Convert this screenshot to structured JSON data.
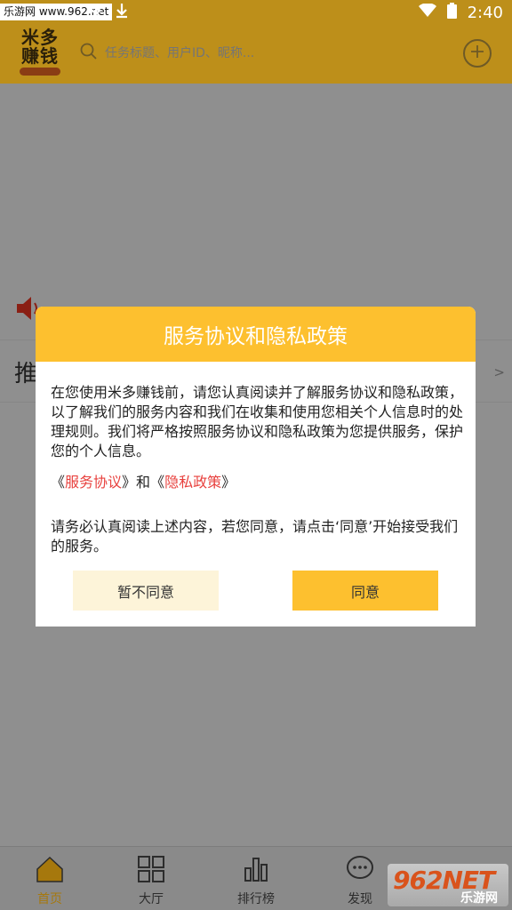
{
  "status_bar": {
    "watermark": "乐游网 www.962.net",
    "time": "2:40",
    "icons": [
      "notification-icon",
      "download-icon",
      "download-icon",
      "wifi-icon",
      "battery-icon"
    ]
  },
  "header": {
    "logo_line1": "米多",
    "logo_line2": "赚钱",
    "search_placeholder": "任务标题、用户ID、昵称..."
  },
  "page": {
    "section_title": "推",
    "more": ">"
  },
  "dialog": {
    "title": "服务协议和隐私政策",
    "body": "在您使用米多赚钱前，请您认真阅读并了解服务协议和隐私政策，以了解我们的服务内容和我们在收集和使用您相关个人信息时的处理规则。我们将严格按照服务协议和隐私政策为您提供服务，保护您的个人信息。",
    "link_open1": "《",
    "link_service": "服务协议",
    "link_close1": "》",
    "link_and": "和",
    "link_open2": "《",
    "link_privacy": "隐私政策",
    "link_close2": "》",
    "notice": "请务必认真阅读上述内容，若您同意，请点击‘同意’开始接受我们的服务。",
    "disagree": "暂不同意",
    "agree": "同意"
  },
  "bottom_nav": [
    {
      "label": "首页",
      "icon": "home-icon",
      "active": true
    },
    {
      "label": "大厅",
      "icon": "grid-icon",
      "active": false
    },
    {
      "label": "排行榜",
      "icon": "ranking-icon",
      "active": false
    },
    {
      "label": "发现",
      "icon": "chat-icon",
      "active": false
    }
  ],
  "watermark_bottom": {
    "big": "962NET",
    "small": "乐游网"
  },
  "colors": {
    "header_bg": "#bd8f1a",
    "dialog_accent": "#fdc02f",
    "link": "#e8413e",
    "nav_active": "#a6780d"
  }
}
